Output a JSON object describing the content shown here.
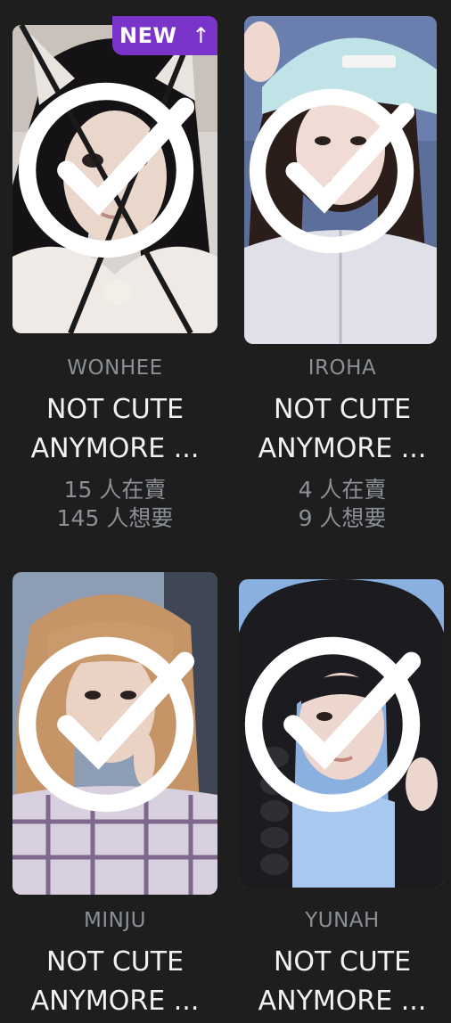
{
  "cards": [
    {
      "member": "WONHEE",
      "title_line1": "NOT CUTE",
      "title_line2": "ANYMORE ...",
      "selling": "15 人在賣",
      "wanted": "145 人想要",
      "badge": "NEW",
      "checked": true
    },
    {
      "member": "IROHA",
      "title_line1": "NOT CUTE",
      "title_line2": "ANYMORE ...",
      "selling": "4 人在賣",
      "wanted": "9 人想要",
      "checked": true
    },
    {
      "member": "MINJU",
      "title_line1": "NOT CUTE",
      "title_line2": "ANYMORE ...",
      "checked": true
    },
    {
      "member": "YUNAH",
      "title_line1": "NOT CUTE",
      "title_line2": "ANYMORE ...",
      "checked": true
    }
  ],
  "colors": {
    "background": "#1e1e1e",
    "badge": "#7b34c9",
    "muted_text": "#8b8f96",
    "title_text": "#f2f2f2"
  }
}
